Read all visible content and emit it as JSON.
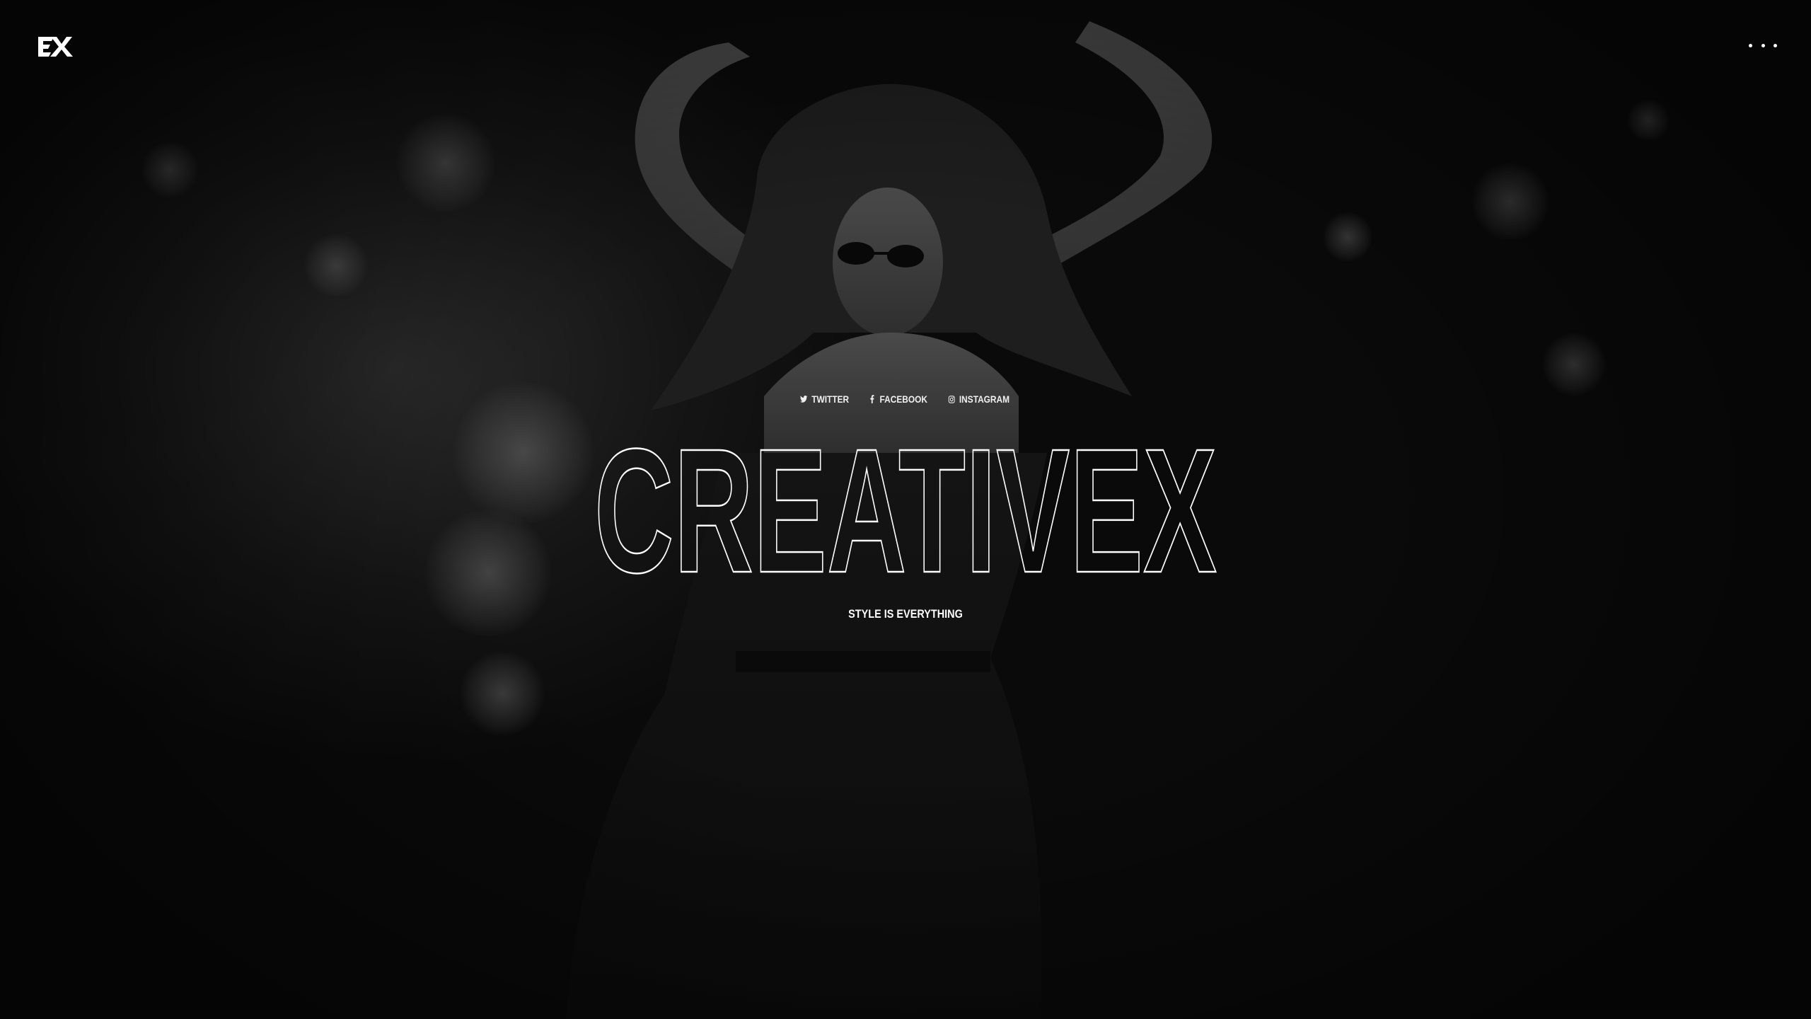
{
  "brand": {
    "logo_text": "EX"
  },
  "header": {
    "menu_icon": "more-horizontal-icon"
  },
  "social": [
    {
      "label": "TWITTER",
      "icon": "twitter-icon"
    },
    {
      "label": "FACEBOOK",
      "icon": "facebook-icon"
    },
    {
      "label": "INSTAGRAM",
      "icon": "instagram-icon"
    }
  ],
  "hero": {
    "title": "CREATIVEX",
    "tagline": "STYLE IS EVERYTHING"
  },
  "colors": {
    "text": "#ffffff",
    "background": "#121212"
  }
}
